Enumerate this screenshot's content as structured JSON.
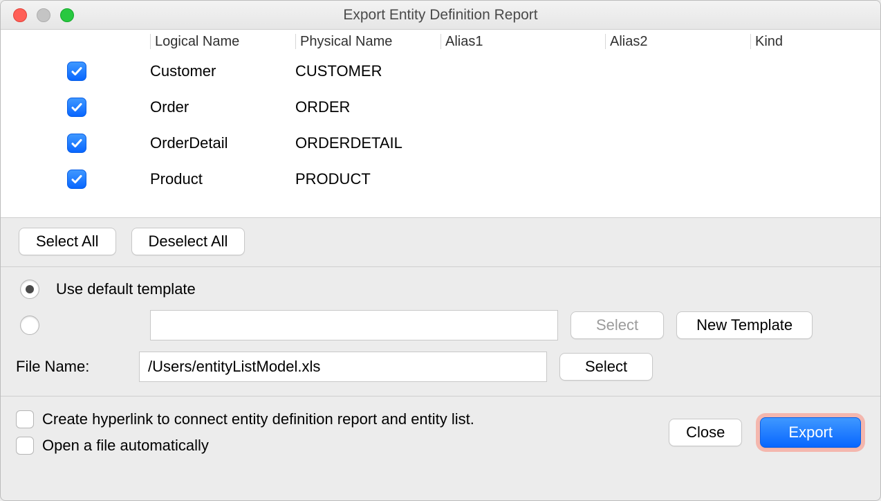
{
  "window": {
    "title": "Export Entity Definition Report"
  },
  "table": {
    "headers": {
      "logical": "Logical Name",
      "physical": "Physical Name",
      "alias1": "Alias1",
      "alias2": "Alias2",
      "kind": "Kind"
    },
    "rows": [
      {
        "checked": true,
        "logical": "Customer",
        "physical": "CUSTOMER",
        "alias1": "",
        "alias2": "",
        "kind": ""
      },
      {
        "checked": true,
        "logical": "Order",
        "physical": "ORDER",
        "alias1": "",
        "alias2": "",
        "kind": ""
      },
      {
        "checked": true,
        "logical": "OrderDetail",
        "physical": "ORDERDETAIL",
        "alias1": "",
        "alias2": "",
        "kind": ""
      },
      {
        "checked": true,
        "logical": "Product",
        "physical": "PRODUCT",
        "alias1": "",
        "alias2": "",
        "kind": ""
      }
    ]
  },
  "buttons": {
    "select_all": "Select All",
    "deselect_all": "Deselect All",
    "template_select": "Select",
    "new_template": "New Template",
    "file_select": "Select",
    "close": "Close",
    "export": "Export"
  },
  "template": {
    "use_default_label": "Use default template",
    "use_default_selected": true,
    "custom_path": ""
  },
  "file": {
    "label": "File Name:",
    "value": "/Users/entityListModel.xls"
  },
  "options": {
    "hyperlink_label": "Create hyperlink to connect entity definition report and entity list.",
    "hyperlink_checked": false,
    "open_auto_label": "Open a file automatically",
    "open_auto_checked": false
  }
}
